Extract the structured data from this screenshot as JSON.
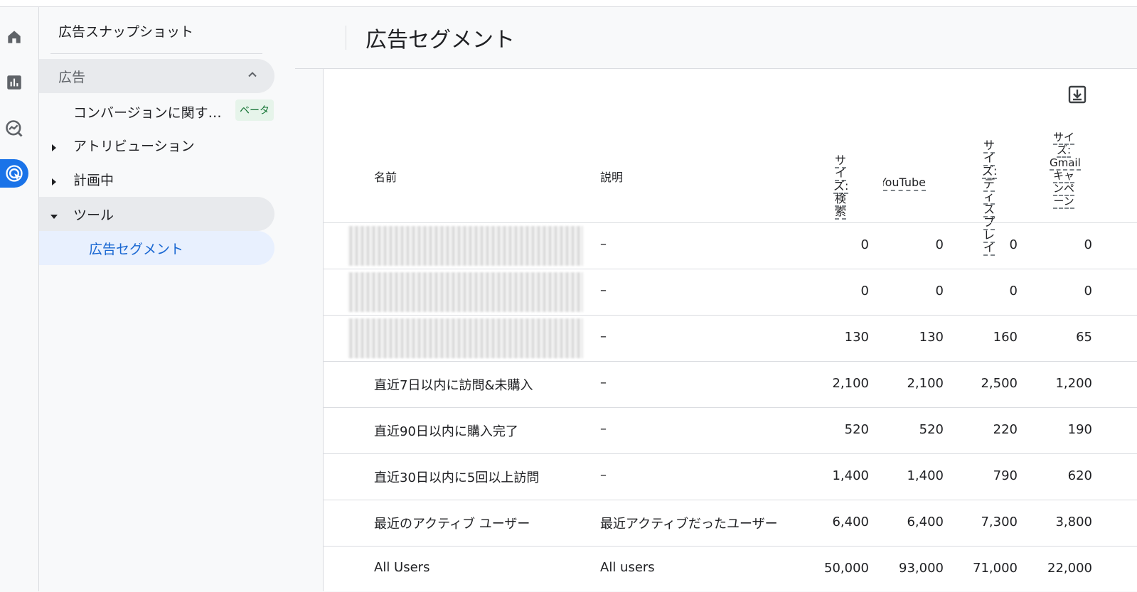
{
  "nav": {
    "title": "広告スナップショット",
    "group_label": "広告",
    "items": [
      {
        "label": "コンバージョンに関す…",
        "badge": "ベータ"
      },
      {
        "label": "アトリビューション"
      },
      {
        "label": "計画中"
      },
      {
        "label": "ツール"
      },
      {
        "label": "広告セグメント"
      }
    ]
  },
  "rail_icons": [
    "home-icon",
    "reports-icon",
    "explore-icon",
    "advertising-icon"
  ],
  "page": {
    "title": "広告セグメント"
  },
  "table": {
    "headers": {
      "name": "名前",
      "description": "説明",
      "size_search": [
        "サイ",
        "ズ:",
        "検索"
      ],
      "size_youtube": "サイズ: YouTube",
      "size_display": [
        "サイ",
        "ズ:",
        "ディ",
        "スプ",
        "レイ"
      ],
      "size_gmail": [
        "サイ",
        "ズ:",
        "Gmail",
        "キャ",
        "ンペ",
        "ーン"
      ]
    },
    "rows": [
      {
        "name": "",
        "description": "–",
        "search": "0",
        "youtube": "0",
        "display": "0",
        "gmail": "0"
      },
      {
        "name": "",
        "description": "–",
        "search": "0",
        "youtube": "0",
        "display": "0",
        "gmail": "0"
      },
      {
        "name": "",
        "description": "–",
        "search": "130",
        "youtube": "130",
        "display": "160",
        "gmail": "65"
      },
      {
        "name": "直近7日以内に訪問&未購入",
        "description": "–",
        "search": "2,100",
        "youtube": "2,100",
        "display": "2,500",
        "gmail": "1,200"
      },
      {
        "name": "直近90日以内に購入完了",
        "description": "–",
        "search": "520",
        "youtube": "520",
        "display": "220",
        "gmail": "190"
      },
      {
        "name": "直近30日以内に5回以上訪問",
        "description": "–",
        "search": "1,400",
        "youtube": "1,400",
        "display": "790",
        "gmail": "620"
      },
      {
        "name": "最近のアクティブ ユーザー",
        "description": "最近アクティブだったユーザー",
        "search": "6,400",
        "youtube": "6,400",
        "display": "7,300",
        "gmail": "3,800"
      },
      {
        "name": "All Users",
        "description": "All users",
        "search": "50,000",
        "youtube": "93,000",
        "display": "71,000",
        "gmail": "22,000"
      }
    ]
  },
  "colors": {
    "accent": "#1a73e8",
    "selected_bg": "#e8f0fe",
    "badge_bg": "#e6f4ea",
    "badge_fg": "#137333"
  }
}
